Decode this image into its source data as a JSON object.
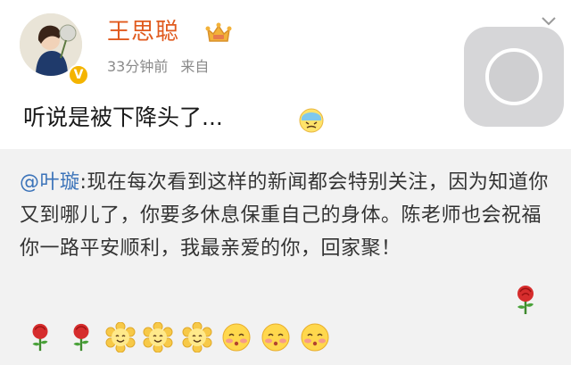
{
  "post": {
    "username": "王思聪",
    "time": "33分钟前",
    "source": "来自",
    "text": "听说是被下降头了...",
    "badge": "V"
  },
  "repost": {
    "mention": "@叶璇",
    "text": ":现在每次看到这样的新闻都会特别关注，因为知道你又到哪儿了，你要多休息保重自己的身体。陈老师也会祝福你一路平安顺利，我最亲爱的你，回家聚！"
  },
  "icons": {
    "crown": "crown-icon",
    "face": "cold-sweat-face-icon",
    "rose": "rose-icon",
    "flower_smile": "smiling-flower-icon",
    "blush": "blushing-face-icon",
    "chevron": "chevron-down-icon"
  },
  "colors": {
    "username": "#e05a1e",
    "mention": "#3b73b9",
    "badge": "#f4b400",
    "repost_bg": "#f2f2f2"
  }
}
